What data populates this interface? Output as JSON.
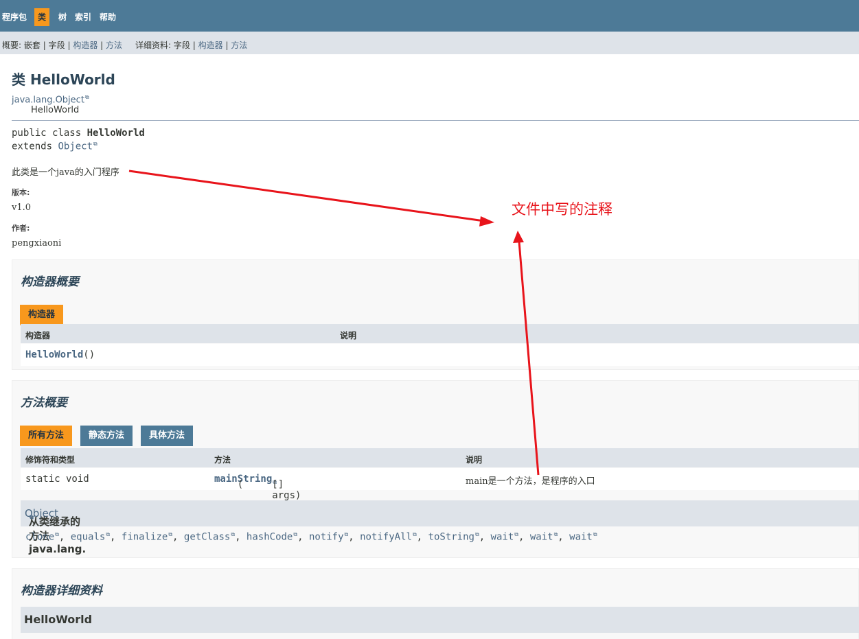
{
  "nav": {
    "items": [
      {
        "label": "程序包",
        "active": false
      },
      {
        "label": "类",
        "active": true
      },
      {
        "label": "树",
        "active": false
      },
      {
        "label": "索引",
        "active": false
      },
      {
        "label": "帮助",
        "active": false
      }
    ]
  },
  "subnav": {
    "summary_label": "概要:",
    "summary_nested": "嵌套",
    "summary_field": "字段",
    "summary_constructor": "构造器",
    "summary_method": "方法",
    "sep": "|",
    "detail_label": "详细资料:",
    "detail_field": "字段",
    "detail_constructor": "构造器",
    "detail_method": "方法"
  },
  "page": {
    "title": "类 HelloWorld",
    "inheritance_root": "java.lang.Object",
    "inheritance_class": "HelloWorld",
    "signature_prefix": "public class ",
    "signature_name": "HelloWorld",
    "extends_prefix": "extends ",
    "extends_link": "Object",
    "description": "此类是一个java的入门程序",
    "version_label": "版本:",
    "version_value": "v1.0",
    "author_label": "作者:",
    "author_value": "pengxiaoni"
  },
  "annotation": {
    "text": "文件中写的注释",
    "color": "#e8141b"
  },
  "constructor_summary": {
    "title": "构造器概要",
    "tab": "构造器",
    "col_constructor": "构造器",
    "col_description": "说明",
    "row_name": "HelloWorld",
    "row_params": "()"
  },
  "method_summary": {
    "title": "方法概要",
    "tabs": [
      "所有方法",
      "静态方法",
      "具体方法"
    ],
    "col_modifier": "修饰符和类型",
    "col_method": "方法",
    "col_description": "说明",
    "row_modifier": "static void",
    "row_method_name": "main",
    "row_method_open": "(",
    "row_param_type": "String",
    "row_param_rest": "[] args)",
    "row_description": "main是一个方法，是程序的入口",
    "inherited_prefix": "从类继承的方法 java.lang.",
    "inherited_class": "Object",
    "inherited_methods": [
      "clone",
      "equals",
      "finalize",
      "getClass",
      "hashCode",
      "notify",
      "notifyAll",
      "toString",
      "wait",
      "wait",
      "wait"
    ]
  },
  "constructor_detail": {
    "title": "构造器详细资料",
    "item": "HelloWorld"
  },
  "colors": {
    "nav_bg": "#4d7a97",
    "active_tab": "#f8981d",
    "subnav_bg": "#dee3e9",
    "link": "#4a6782"
  }
}
